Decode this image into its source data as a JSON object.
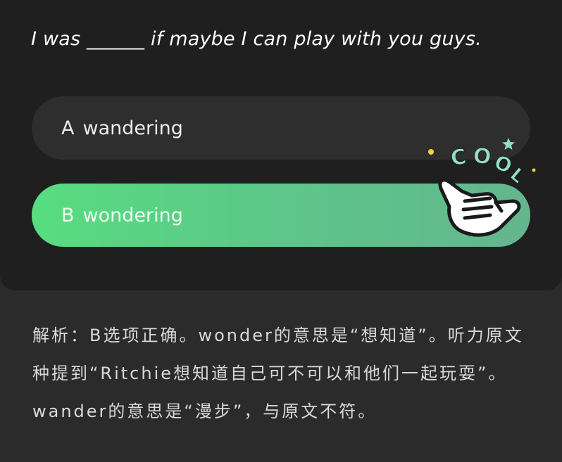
{
  "question": {
    "text": "I was ______ if maybe I can play with you guys."
  },
  "options": [
    {
      "letter": "A",
      "text": "wandering"
    },
    {
      "letter": "B",
      "text": "wondering"
    }
  ],
  "sticker": {
    "label": "COOL"
  },
  "explanation": {
    "text": "解析：B选项正确。wonder的意思是“想知道”。听力原文种提到“Ritchie想知道自己可不可以和他们一起玩耍”。wander的意思是“漫步”，与原文不符。"
  },
  "colors": {
    "background": "#2b2b2b",
    "card": "#1f1f1f",
    "option_default": "#2e2e2e",
    "option_correct_start": "#58dd80",
    "option_correct_end": "#64b58f",
    "sticker_text": "#8fe0c0"
  }
}
